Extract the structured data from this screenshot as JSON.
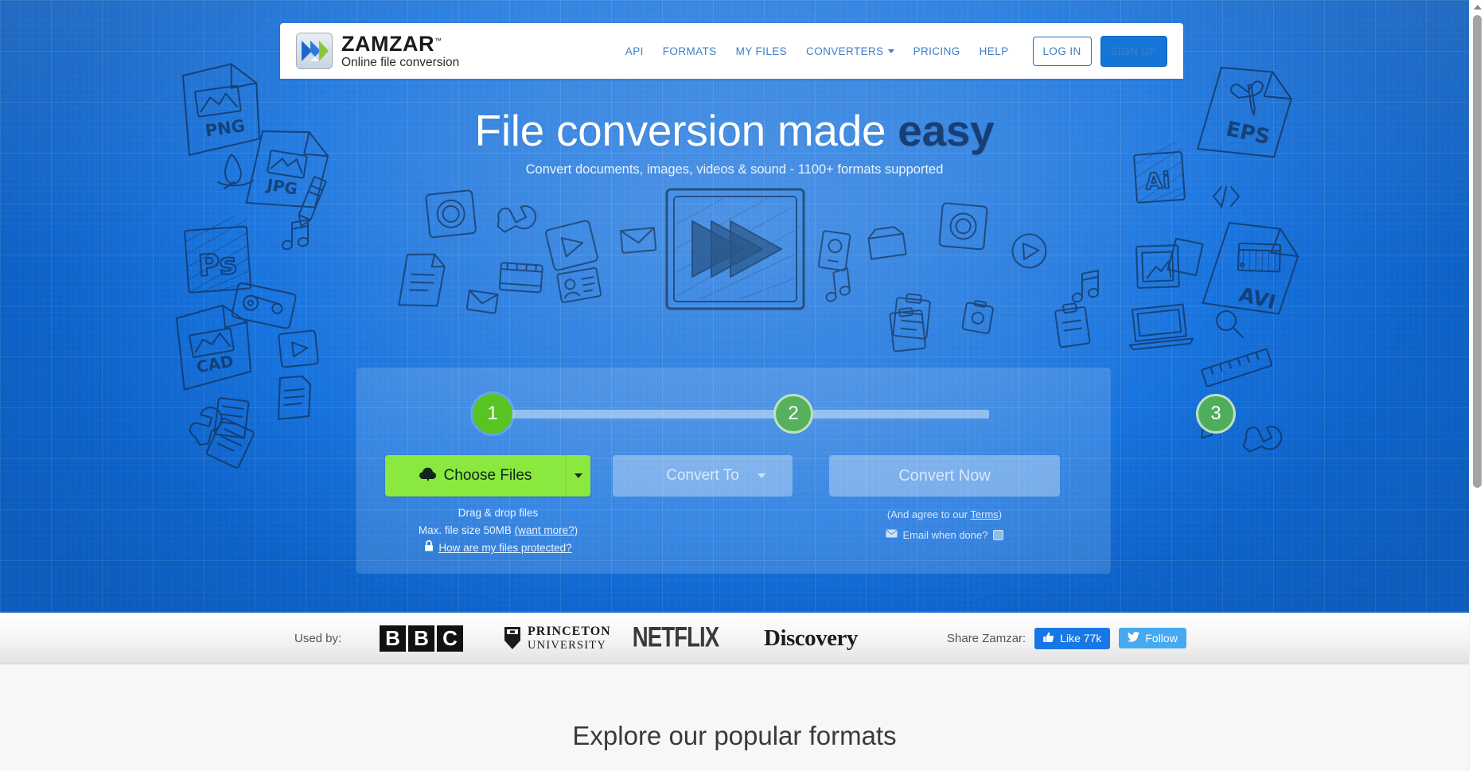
{
  "brand": {
    "name": "ZAMZAR",
    "tm": "™",
    "tagline": "Online file conversion",
    "logo_icon": "double-chevron-logo"
  },
  "nav": {
    "items": [
      {
        "label": "API",
        "has_caret": false
      },
      {
        "label": "FORMATS",
        "has_caret": false
      },
      {
        "label": "MY FILES",
        "has_caret": false
      },
      {
        "label": "CONVERTERS",
        "has_caret": true
      },
      {
        "label": "PRICING",
        "has_caret": false
      },
      {
        "label": "HELP",
        "has_caret": false
      }
    ],
    "login_label": "LOG IN",
    "signup_label": "SIGN UP",
    "link_color": "#3f7ec4",
    "signup_bg": "#1575d6"
  },
  "hero": {
    "title_normal": "File conversion made ",
    "title_bold": "easy",
    "subtitle": "Convert documents, images, videos & sound - 1100+ formats supported",
    "bg_color": "#1773de",
    "accent_dark": "#173f77"
  },
  "widget": {
    "steps": [
      {
        "number": "1",
        "state": "active"
      },
      {
        "number": "2",
        "state": "pending"
      },
      {
        "number": "3",
        "state": "pending"
      }
    ],
    "choose_files_label": "Choose Files",
    "choose_files_icon": "upload-cloud-icon",
    "choose_files_color": "#8ae83f",
    "convert_to_label": "Convert To",
    "convert_now_label": "Convert Now",
    "drag_drop_text": "Drag & drop files",
    "max_size_text": "Max. file size 50MB ",
    "want_more_label": "(want more?)",
    "protected_label": "How are my files protected?",
    "protected_icon": "lock-icon",
    "agree_prefix": "(And agree to our ",
    "terms_label": "Terms",
    "agree_suffix": ")",
    "email_icon": "envelope-icon",
    "email_label": "Email when done?",
    "email_checked": false
  },
  "usedby": {
    "label": "Used by:",
    "logos": [
      {
        "name": "BBC",
        "letters": [
          "B",
          "B",
          "C"
        ]
      },
      {
        "name": "Princeton University",
        "line1": "PRINCETON",
        "line2": "UNIVERSITY"
      },
      {
        "name": "NETFLIX",
        "text": "NETFLIX"
      },
      {
        "name": "Discovery",
        "text": "Discovery"
      }
    ],
    "share_label": "Share Zamzar:",
    "facebook_label": "Like 77k",
    "facebook_icon": "thumbs-up-icon",
    "twitter_label": "Follow",
    "twitter_icon": "twitter-bird-icon"
  },
  "explore": {
    "heading": "Explore our popular formats"
  },
  "doodles": {
    "labels": [
      "PNG",
      "JPG",
      "Ps",
      "CAD",
      "EPS",
      "Ai",
      "AVI"
    ]
  },
  "scrollbar": {
    "position": "right",
    "thumb_color": "#a3a3a3"
  }
}
